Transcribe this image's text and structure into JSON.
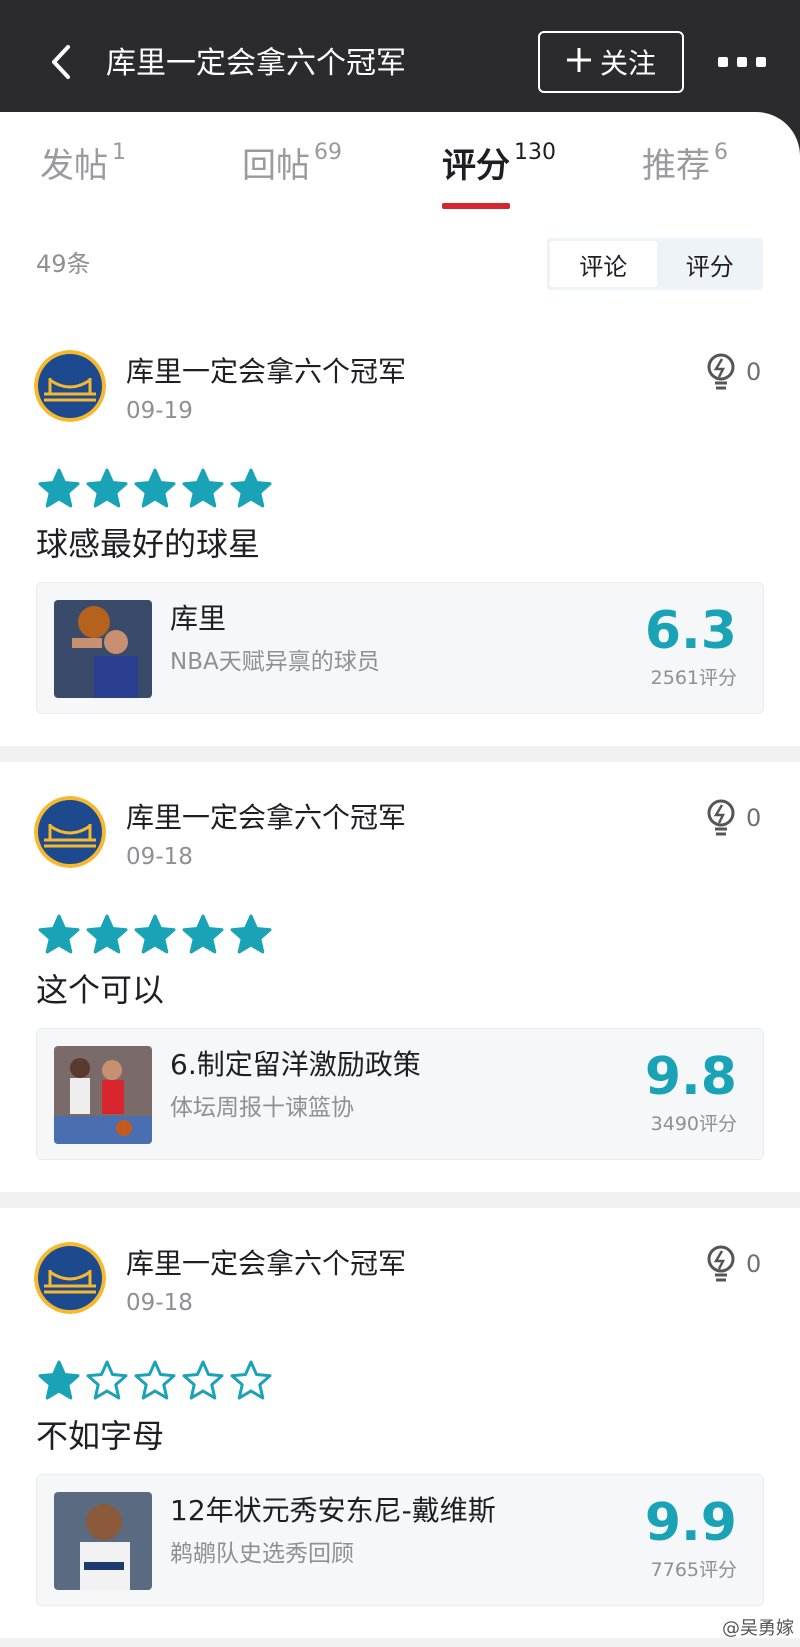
{
  "header": {
    "title": "库里一定会拿六个冠军",
    "follow_label": "关注"
  },
  "tabs": [
    {
      "label": "发帖",
      "count": "1"
    },
    {
      "label": "回帖",
      "count": "69"
    },
    {
      "label": "评分",
      "count": "130",
      "active": true
    },
    {
      "label": "推荐",
      "count": "6"
    }
  ],
  "list": {
    "total": "49条",
    "toggle": {
      "comment": "评论",
      "rating": "评分",
      "selected": "评分"
    }
  },
  "posts": [
    {
      "author": "库里一定会拿六个冠军",
      "date": "09-19",
      "likes": "0",
      "stars": 5,
      "text": "球感最好的球星",
      "card": {
        "title": "库里",
        "subtitle": "NBA天赋异禀的球员",
        "score": "6.3",
        "ratings": "2561评分"
      }
    },
    {
      "author": "库里一定会拿六个冠军",
      "date": "09-18",
      "likes": "0",
      "stars": 5,
      "text": "这个可以",
      "card": {
        "title": "6.制定留洋激励政策",
        "subtitle": "体坛周报十谏篮协",
        "score": "9.8",
        "ratings": "3490评分"
      }
    },
    {
      "author": "库里一定会拿六个冠军",
      "date": "09-18",
      "likes": "0",
      "stars": 1,
      "text": "不如字母",
      "card": {
        "title": "12年状元秀安东尼-戴维斯",
        "subtitle": "鹈鹕队史选秀回顾",
        "score": "9.9",
        "ratings": "7765评分"
      }
    }
  ],
  "watermark": "@吴勇嫁",
  "colors": {
    "accent": "#1aa2b6",
    "tab_indicator": "#d9252d",
    "header_bg": "#2b2b2e"
  }
}
